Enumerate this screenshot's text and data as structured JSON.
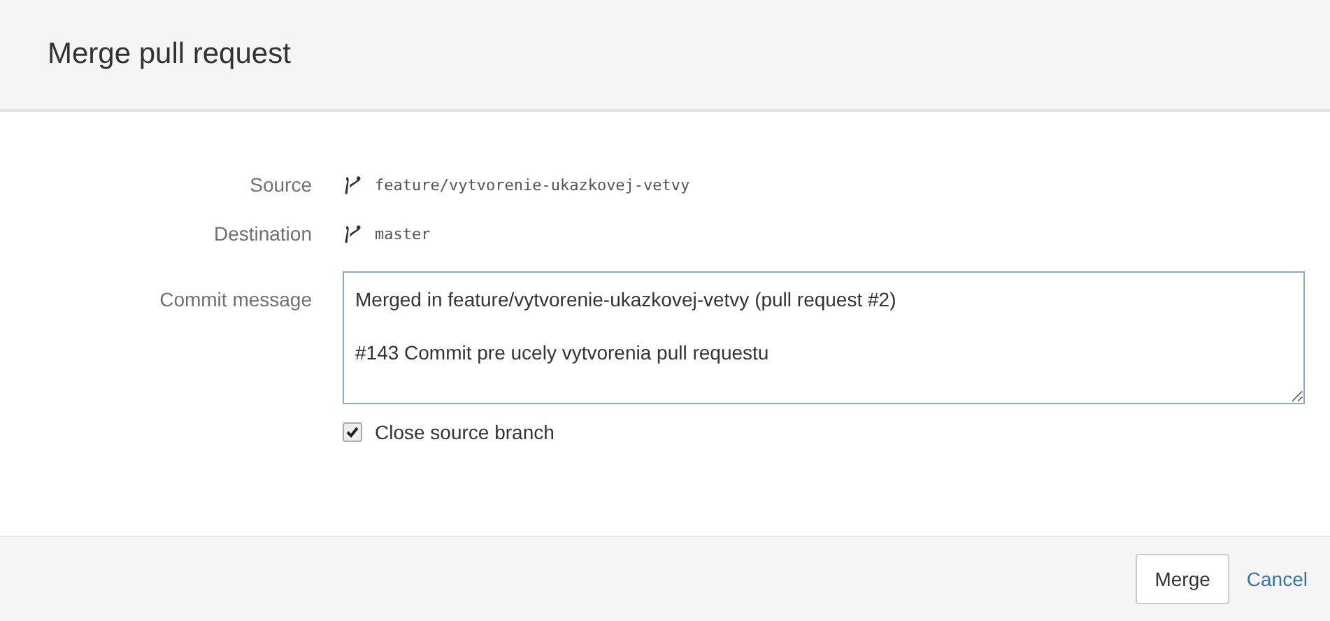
{
  "dialog": {
    "title": "Merge pull request"
  },
  "fields": [
    {
      "label": "Source",
      "kind": "branch",
      "value": "feature/vytvorenie-ukazkovej-vetvy"
    },
    {
      "label": "Destination",
      "kind": "branch",
      "value": "master"
    },
    {
      "label": "Commit message",
      "kind": "textarea",
      "value": "Merged in feature/vytvorenie-ukazkovej-vetvy (pull request #2)\n\n#143 Commit pre ucely vytvorenia pull requestu"
    }
  ],
  "close_source_branch": {
    "label": "Close source branch",
    "checked": true
  },
  "buttons": [
    {
      "label": "Merge",
      "kind": "button"
    },
    {
      "label": "Cancel",
      "kind": "link"
    }
  ]
}
